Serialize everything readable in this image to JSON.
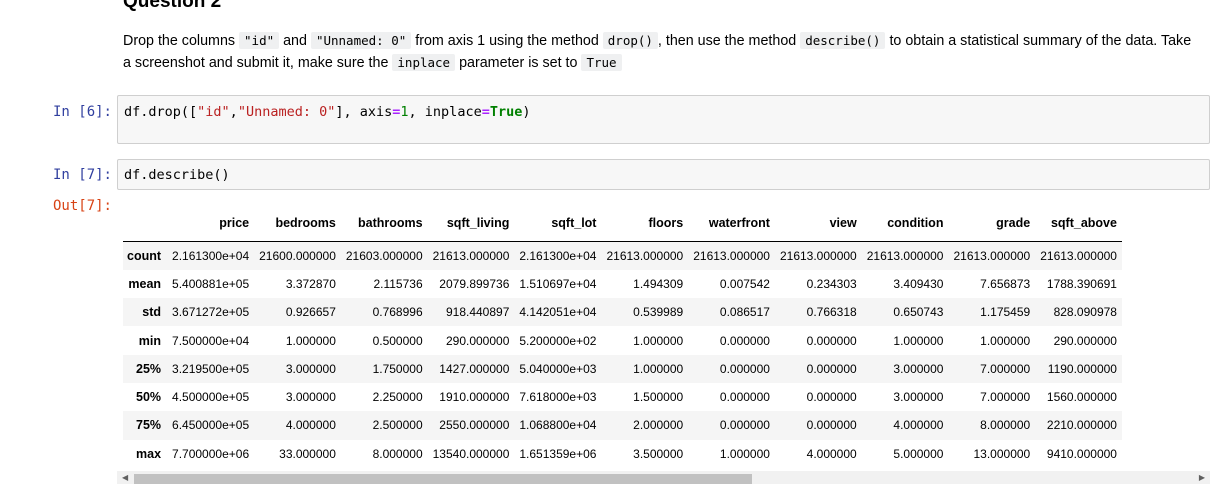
{
  "markdown": {
    "heading": "Question 2",
    "parts": [
      {
        "t": "text",
        "v": "Drop the columns "
      },
      {
        "t": "code",
        "v": "\"id\""
      },
      {
        "t": "text",
        "v": " and "
      },
      {
        "t": "code",
        "v": "\"Unnamed: 0\""
      },
      {
        "t": "text",
        "v": " from axis 1 using the method "
      },
      {
        "t": "code",
        "v": "drop()"
      },
      {
        "t": "text",
        "v": ", then use the method "
      },
      {
        "t": "code",
        "v": "describe()"
      },
      {
        "t": "text",
        "v": " to obtain a statistical summary of the data. Take a screenshot and submit it, make sure the "
      },
      {
        "t": "code",
        "v": "inplace"
      },
      {
        "t": "text",
        "v": " parameter is set to "
      },
      {
        "t": "code",
        "v": "True"
      }
    ]
  },
  "cells": [
    {
      "prompt": "In [6]:",
      "tokens": [
        {
          "c": "",
          "v": "df.drop(["
        },
        {
          "c": "s",
          "v": "\"id\""
        },
        {
          "c": "",
          "v": ","
        },
        {
          "c": "s",
          "v": "\"Unnamed: 0\""
        },
        {
          "c": "",
          "v": "], axis"
        },
        {
          "c": "o",
          "v": "="
        },
        {
          "c": "n",
          "v": "1"
        },
        {
          "c": "",
          "v": ", inplace"
        },
        {
          "c": "o",
          "v": "="
        },
        {
          "c": "k",
          "v": "True"
        },
        {
          "c": "",
          "v": ")"
        }
      ]
    },
    {
      "prompt": "In [7]:",
      "tokens": [
        {
          "c": "",
          "v": "df.describe()"
        }
      ]
    }
  ],
  "output": {
    "prompt": "Out[7]:",
    "table": {
      "columns": [
        "price",
        "bedrooms",
        "bathrooms",
        "sqft_living",
        "sqft_lot",
        "floors",
        "waterfront",
        "view",
        "condition",
        "grade",
        "sqft_above"
      ],
      "rows": [
        {
          "label": "count",
          "values": [
            "2.161300e+04",
            "21600.000000",
            "21603.000000",
            "21613.000000",
            "2.161300e+04",
            "21613.000000",
            "21613.000000",
            "21613.000000",
            "21613.000000",
            "21613.000000",
            "21613.000000"
          ]
        },
        {
          "label": "mean",
          "values": [
            "5.400881e+05",
            "3.372870",
            "2.115736",
            "2079.899736",
            "1.510697e+04",
            "1.494309",
            "0.007542",
            "0.234303",
            "3.409430",
            "7.656873",
            "1788.390691"
          ]
        },
        {
          "label": "std",
          "values": [
            "3.671272e+05",
            "0.926657",
            "0.768996",
            "918.440897",
            "4.142051e+04",
            "0.539989",
            "0.086517",
            "0.766318",
            "0.650743",
            "1.175459",
            "828.090978"
          ]
        },
        {
          "label": "min",
          "values": [
            "7.500000e+04",
            "1.000000",
            "0.500000",
            "290.000000",
            "5.200000e+02",
            "1.000000",
            "0.000000",
            "0.000000",
            "1.000000",
            "1.000000",
            "290.000000"
          ]
        },
        {
          "label": "25%",
          "values": [
            "3.219500e+05",
            "3.000000",
            "1.750000",
            "1427.000000",
            "5.040000e+03",
            "1.000000",
            "0.000000",
            "0.000000",
            "3.000000",
            "7.000000",
            "1190.000000"
          ]
        },
        {
          "label": "50%",
          "values": [
            "4.500000e+05",
            "3.000000",
            "2.250000",
            "1910.000000",
            "7.618000e+03",
            "1.500000",
            "0.000000",
            "0.000000",
            "3.000000",
            "7.000000",
            "1560.000000"
          ]
        },
        {
          "label": "75%",
          "values": [
            "6.450000e+05",
            "4.000000",
            "2.500000",
            "2550.000000",
            "1.068800e+04",
            "2.000000",
            "0.000000",
            "0.000000",
            "4.000000",
            "8.000000",
            "2210.000000"
          ]
        },
        {
          "label": "max",
          "values": [
            "7.700000e+06",
            "33.000000",
            "8.000000",
            "13540.000000",
            "1.651359e+06",
            "3.500000",
            "1.000000",
            "4.000000",
            "5.000000",
            "13.000000",
            "9410.000000"
          ]
        }
      ]
    }
  },
  "scrollbar": {
    "left_arrow": "◀",
    "right_arrow": "▶"
  }
}
